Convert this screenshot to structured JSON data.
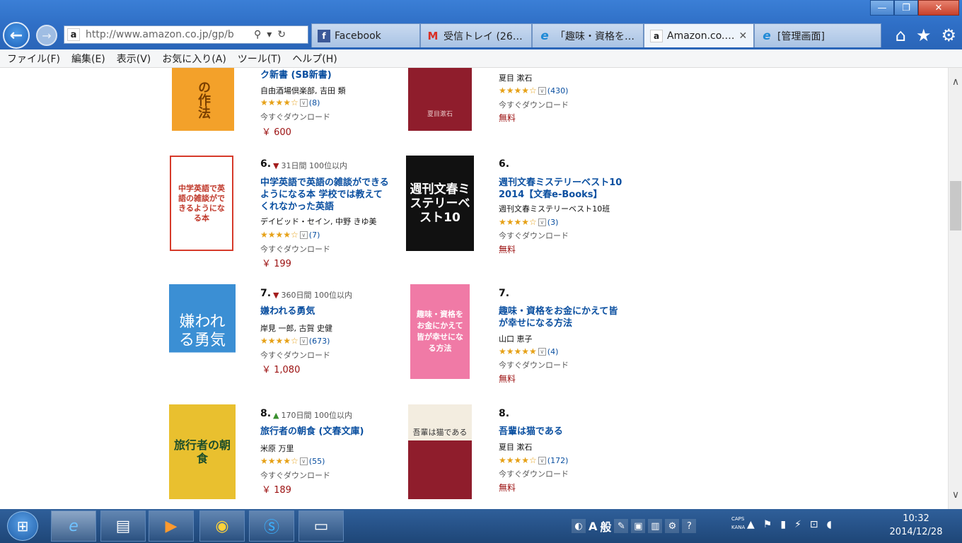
{
  "browser": {
    "url": "http://www.amazon.co.jp/gp/b",
    "window_controls": {
      "minimize": "—",
      "maximize": "❐",
      "close": "✕"
    },
    "tabs": [
      {
        "label": "Facebook",
        "icon": "f",
        "icon_name": "facebook-icon",
        "active": false
      },
      {
        "label": "受信トレイ (26…",
        "icon": "M",
        "icon_name": "gmail-icon",
        "active": false
      },
      {
        "label": "「趣味・資格を…",
        "icon": "e",
        "icon_name": "ie-page-icon",
        "active": false
      },
      {
        "label": "Amazon.co.…",
        "icon": "a",
        "icon_name": "amazon-icon",
        "active": true,
        "close": "✕"
      },
      {
        "label": "[管理画面]",
        "icon": "e",
        "icon_name": "ie-page-icon",
        "active": false
      }
    ]
  },
  "menu": [
    "ファイル(F)",
    "編集(E)",
    "表示(V)",
    "お気に入り(A)",
    "ツール(T)",
    "ヘルプ(H)"
  ],
  "left_column": [
    {
      "title": "ク新書 (SB新書)",
      "author": "自由酒場倶楽部, 吉田 類",
      "stars": "★★★★☆",
      "rating_count": "(8)",
      "download": "今すぐダウンロード",
      "price": "￥ 600",
      "cover_text": "の作法"
    },
    {
      "rank": "6.",
      "trend": "31日間 100位以内",
      "trend_dir": "down",
      "title": "中学英語で英語の雑談ができるようになる本 学校では教えてくれなかった英語",
      "author": "デイビッド・セイン, 中野 きゆ美",
      "stars": "★★★★☆",
      "rating_count": "(7)",
      "download": "今すぐダウンロード",
      "price": "￥ 199",
      "cover_text": "中学英語で英語の雑談ができるようになる本"
    },
    {
      "rank": "7.",
      "trend": "360日間 100位以内",
      "trend_dir": "down",
      "title": "嫌われる勇気",
      "author": "岸見 一郎, 古賀 史健",
      "stars": "★★★★☆",
      "rating_count": "(673)",
      "download": "今すぐダウンロード",
      "price": "￥ 1,080",
      "cover_text": "嫌われる勇気"
    },
    {
      "rank": "8.",
      "trend": "170日間 100位以内",
      "trend_dir": "up",
      "title": "旅行者の朝食 (文春文庫)",
      "author": "米原 万里",
      "stars": "★★★★☆",
      "rating_count": "(55)",
      "download": "今すぐダウンロード",
      "price": "￥ 189",
      "cover_text": "旅行者の朝食"
    }
  ],
  "right_column": [
    {
      "author": "夏目 漱石",
      "stars": "★★★★☆",
      "rating_count": "(430)",
      "download": "今すぐダウンロード",
      "price": "無料",
      "cover_text": "夏目漱石"
    },
    {
      "rank": "6.",
      "title": "週刊文春ミステリーベスト10 2014【文春e-Books】",
      "author": "週刊文春ミステリーベスト10班",
      "stars": "★★★★☆",
      "rating_count": "(3)",
      "download": "今すぐダウンロード",
      "price": "無料",
      "cover_text": "週刊文春ミステリーベスト10"
    },
    {
      "rank": "7.",
      "title": "趣味・資格をお金にかえて皆が幸せになる方法",
      "author": "山口 恵子",
      "stars": "★★★★★",
      "rating_count": "(4)",
      "download": "今すぐダウンロード",
      "price": "無料",
      "cover_text": "趣味・資格をお金にかえて皆が幸せになる方法"
    },
    {
      "rank": "8.",
      "title": "吾輩は猫である",
      "author": "夏目 漱石",
      "stars": "★★★★☆",
      "rating_count": "(172)",
      "download": "今すぐダウンロード",
      "price": "無料",
      "cover_text": "吾輩は猫である"
    }
  ],
  "taskbar": {
    "ime_mode": "A",
    "ime_label": "般",
    "caps": "CAPS",
    "kana": "KANA",
    "time": "10:32",
    "date": "2014/12/28"
  },
  "colors": {
    "link": "#0a4fa0",
    "price": "#9b1010",
    "star": "#e6a117",
    "titlebar": "#2f6fc6",
    "taskbar": "#1e4677"
  }
}
